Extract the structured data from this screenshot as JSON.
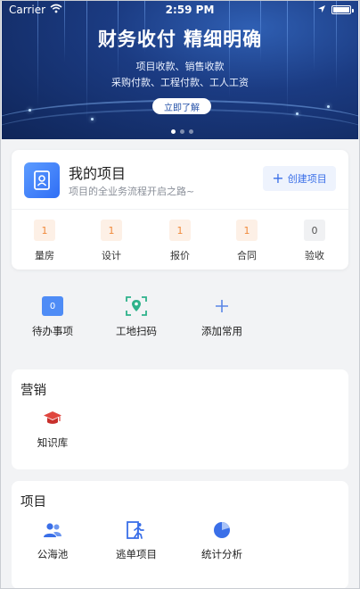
{
  "status_bar": {
    "carrier": "Carrier",
    "time": "2:59 PM"
  },
  "banner": {
    "title": "财务收付  精细明确",
    "line1": "项目收款、销售收款",
    "line2": "采购付款、工程付款、工人工资",
    "button": "立即了解",
    "page_count": 3,
    "active_page": 1
  },
  "project": {
    "title": "我的项目",
    "subtitle": "项目的全业务流程开启之路~",
    "create_button": "创建项目",
    "stats": [
      {
        "label": "量房",
        "count": "1"
      },
      {
        "label": "设计",
        "count": "1"
      },
      {
        "label": "报价",
        "count": "1"
      },
      {
        "label": "合同",
        "count": "1"
      },
      {
        "label": "验收",
        "count": "0"
      }
    ]
  },
  "quick": {
    "items": [
      {
        "label": "待办事项",
        "badge": "0",
        "icon": "todo-icon"
      },
      {
        "label": "工地扫码",
        "icon": "scan-icon"
      },
      {
        "label": "添加常用",
        "icon": "plus-icon"
      }
    ]
  },
  "marketing": {
    "title": "营销",
    "items": [
      {
        "label": "知识库",
        "icon": "graduation-cap-icon"
      }
    ]
  },
  "projects_section": {
    "title": "项目",
    "items": [
      {
        "label": "公海池",
        "icon": "users-icon"
      },
      {
        "label": "逃单项目",
        "icon": "exit-icon"
      },
      {
        "label": "统计分析",
        "icon": "pie-chart-icon"
      }
    ]
  },
  "colors": {
    "accent": "#3a6fe8",
    "badge_orange": "#f08a3c",
    "marketing_icon": "#e0463f"
  }
}
